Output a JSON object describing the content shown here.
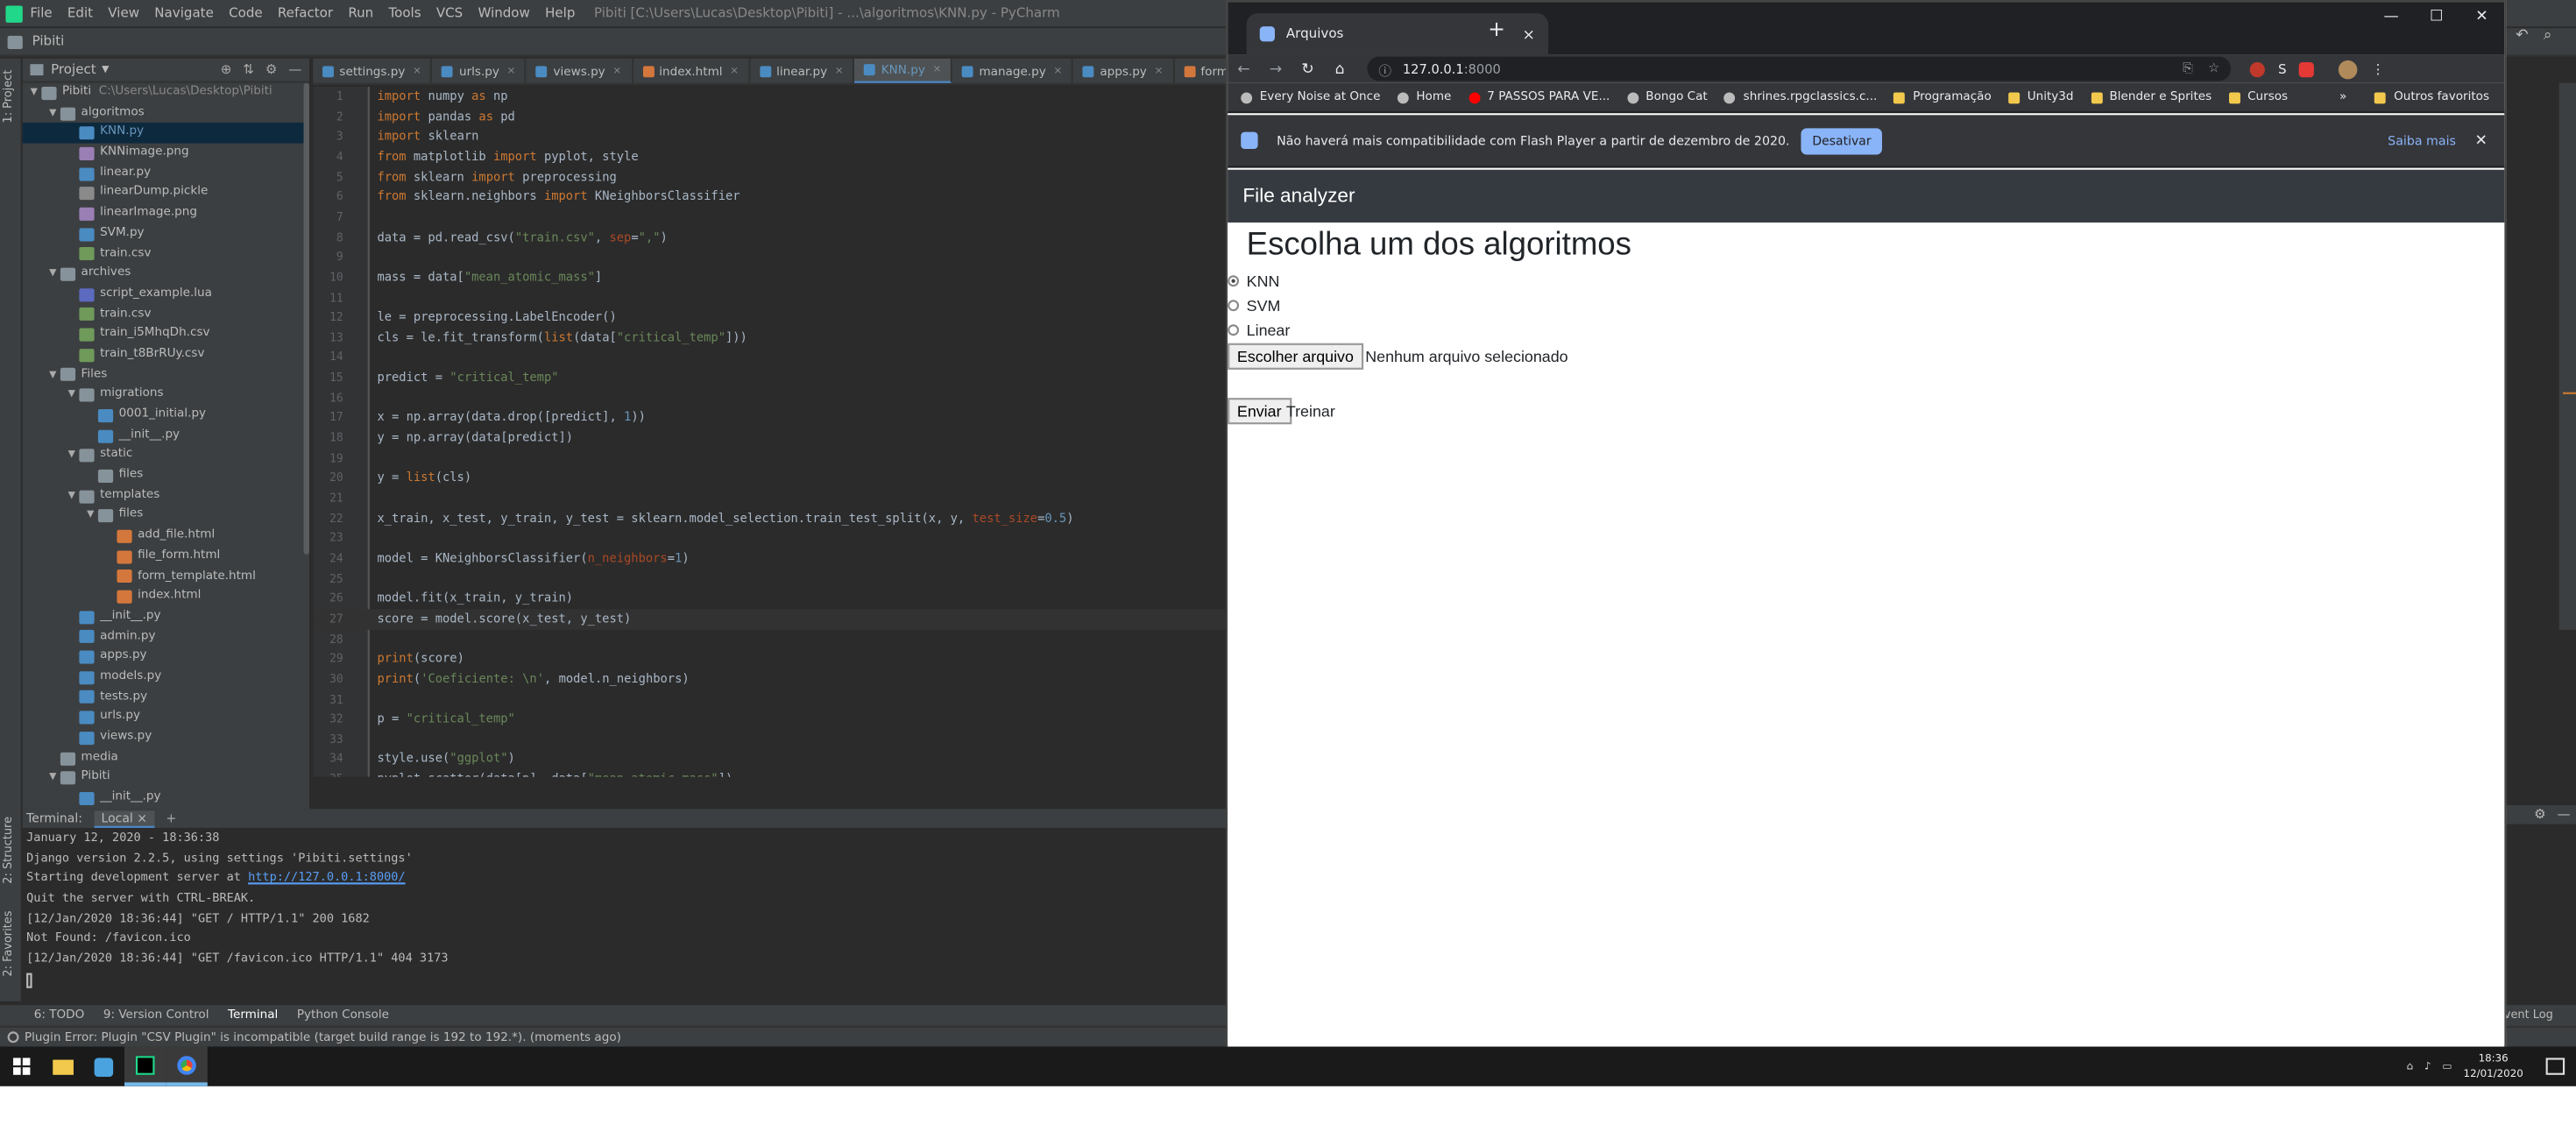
{
  "ide": {
    "title": "Pibiti [C:\\Users\\Lucas\\Desktop\\Pibiti] - ...\\algoritmos\\KNN.py - PyCharm",
    "menu": [
      "File",
      "Edit",
      "View",
      "Navigate",
      "Code",
      "Refactor",
      "Run",
      "Tools",
      "VCS",
      "Window",
      "Help"
    ],
    "nav_project": "Pibiti",
    "project_label": "Project",
    "tree": [
      {
        "name": "Pibiti",
        "sub": "C:\\Users\\Lucas\\Desktop\\Pibiti",
        "depth": 0,
        "arrow": "▼",
        "icon": "folder"
      },
      {
        "name": "algoritmos",
        "depth": 1,
        "arrow": "▼",
        "icon": "folder"
      },
      {
        "name": "KNN.py",
        "depth": 2,
        "icon": "py",
        "sel": true
      },
      {
        "name": "KNNimage.png",
        "depth": 2,
        "icon": "img"
      },
      {
        "name": "linear.py",
        "depth": 2,
        "icon": "py"
      },
      {
        "name": "linearDump.pickle",
        "depth": 2,
        "icon": "pickle"
      },
      {
        "name": "linearImage.png",
        "depth": 2,
        "icon": "img"
      },
      {
        "name": "SVM.py",
        "depth": 2,
        "icon": "py"
      },
      {
        "name": "train.csv",
        "depth": 2,
        "icon": "csv"
      },
      {
        "name": "archives",
        "depth": 1,
        "arrow": "▼",
        "icon": "folder"
      },
      {
        "name": "script_example.lua",
        "depth": 2,
        "icon": "lua"
      },
      {
        "name": "train.csv",
        "depth": 2,
        "icon": "csv"
      },
      {
        "name": "train_i5MhqDh.csv",
        "depth": 2,
        "icon": "csv"
      },
      {
        "name": "train_t8BrRUy.csv",
        "depth": 2,
        "icon": "csv"
      },
      {
        "name": "Files",
        "depth": 1,
        "arrow": "▼",
        "icon": "folder"
      },
      {
        "name": "migrations",
        "depth": 2,
        "arrow": "▼",
        "icon": "folder"
      },
      {
        "name": "0001_initial.py",
        "depth": 3,
        "icon": "py"
      },
      {
        "name": "__init__.py",
        "depth": 3,
        "icon": "py"
      },
      {
        "name": "static",
        "depth": 2,
        "arrow": "▼",
        "icon": "folder"
      },
      {
        "name": "files",
        "depth": 3,
        "icon": "folder"
      },
      {
        "name": "templates",
        "depth": 2,
        "arrow": "▼",
        "icon": "folder"
      },
      {
        "name": "files",
        "depth": 3,
        "arrow": "▼",
        "icon": "folder"
      },
      {
        "name": "add_file.html",
        "depth": 4,
        "icon": "html"
      },
      {
        "name": "file_form.html",
        "depth": 4,
        "icon": "html"
      },
      {
        "name": "form_template.html",
        "depth": 4,
        "icon": "html"
      },
      {
        "name": "index.html",
        "depth": 4,
        "icon": "html"
      },
      {
        "name": "__init__.py",
        "depth": 2,
        "icon": "py"
      },
      {
        "name": "admin.py",
        "depth": 2,
        "icon": "py"
      },
      {
        "name": "apps.py",
        "depth": 2,
        "icon": "py"
      },
      {
        "name": "models.py",
        "depth": 2,
        "icon": "py"
      },
      {
        "name": "tests.py",
        "depth": 2,
        "icon": "py"
      },
      {
        "name": "urls.py",
        "depth": 2,
        "icon": "py"
      },
      {
        "name": "views.py",
        "depth": 2,
        "icon": "py"
      },
      {
        "name": "media",
        "depth": 1,
        "icon": "folder"
      },
      {
        "name": "Pibiti",
        "depth": 1,
        "arrow": "▼",
        "icon": "folder"
      },
      {
        "name": "__init__.py",
        "depth": 2,
        "icon": "py"
      }
    ],
    "tabs": [
      {
        "label": "settings.py",
        "type": "py"
      },
      {
        "label": "urls.py",
        "type": "py"
      },
      {
        "label": "views.py",
        "type": "py"
      },
      {
        "label": "index.html",
        "type": "html"
      },
      {
        "label": "linear.py",
        "type": "py"
      },
      {
        "label": "KNN.py",
        "type": "py",
        "active": true
      },
      {
        "label": "manage.py",
        "type": "py"
      },
      {
        "label": "apps.py",
        "type": "py"
      },
      {
        "label": "form_template.html",
        "type": "html"
      }
    ],
    "code": [
      {
        "n": "1",
        "h": "<span class='kw'>import</span> numpy <span class='kw'>as</span> np"
      },
      {
        "n": "2",
        "h": "<span class='kw'>import</span> pandas <span class='kw'>as</span> pd"
      },
      {
        "n": "3",
        "h": "<span class='kw'>import</span> sklearn"
      },
      {
        "n": "4",
        "h": "<span class='kw'>from</span> matplotlib <span class='kw'>import</span> pyplot, style"
      },
      {
        "n": "5",
        "h": "<span class='kw'>from</span> sklearn <span class='kw'>import</span> preprocessing"
      },
      {
        "n": "6",
        "h": "<span class='kw'>from</span> sklearn.neighbors <span class='kw'>import</span> KNeighborsClassifier"
      },
      {
        "n": "7",
        "h": ""
      },
      {
        "n": "8",
        "h": "data = pd.read_csv(<span class='str'>\"train.csv\"</span>, <span class='prm'>sep</span>=<span class='str'>\",\"</span>)"
      },
      {
        "n": "9",
        "h": ""
      },
      {
        "n": "10",
        "h": "mass = data[<span class='str'>\"mean_atomic_mass\"</span>]"
      },
      {
        "n": "11",
        "h": ""
      },
      {
        "n": "12",
        "h": "le = preprocessing.LabelEncoder()"
      },
      {
        "n": "13",
        "h": "cls = le.fit_transform(<span class='kw'>list</span>(data[<span class='str'>\"critical_temp\"</span>]))"
      },
      {
        "n": "14",
        "h": ""
      },
      {
        "n": "15",
        "h": "predict = <span class='str'>\"critical_temp\"</span>"
      },
      {
        "n": "16",
        "h": ""
      },
      {
        "n": "17",
        "h": "x = np.array(data.drop([predict], <span class='num'>1</span>))"
      },
      {
        "n": "18",
        "h": "y = np.array(data[predict])"
      },
      {
        "n": "19",
        "h": ""
      },
      {
        "n": "20",
        "h": "y = <span class='kw'>list</span>(cls)"
      },
      {
        "n": "21",
        "h": ""
      },
      {
        "n": "22",
        "h": "x_train, x_test, y_train, y_test = sklearn.model_selection.train_test_split(x, y, <span class='prm'>test_size</span>=<span class='num'>0.5</span>)"
      },
      {
        "n": "23",
        "h": ""
      },
      {
        "n": "24",
        "h": "model = KNeighborsClassifier(<span class='prm'>n_neighbors</span>=<span class='num'>1</span>)"
      },
      {
        "n": "25",
        "h": ""
      },
      {
        "n": "26",
        "h": "model.fit(x_train, y_train)"
      },
      {
        "n": "27",
        "h": "score = model.score(x_test, y_test)",
        "cur": true
      },
      {
        "n": "28",
        "h": ""
      },
      {
        "n": "29",
        "h": "<span class='kw'>print</span>(score)"
      },
      {
        "n": "30",
        "h": "<span class='kw'>print</span>(<span class='str'>'Coeficiente: \\n'</span>, model.n_neighbors)"
      },
      {
        "n": "31",
        "h": ""
      },
      {
        "n": "32",
        "h": "p = <span class='str'>\"critical_temp\"</span>"
      },
      {
        "n": "33",
        "h": ""
      },
      {
        "n": "34",
        "h": "style.use(<span class='str'>\"ggplot\"</span>)"
      },
      {
        "n": "35",
        "h": "pyplot.scatter(data[p], data[<span class='str'>\"mean_atomic_mass\"</span>])"
      }
    ],
    "terminal": {
      "label": "Terminal:",
      "tab": "Local",
      "lines": [
        "January 12, 2020 - 18:36:38",
        "Django version 2.2.5, using settings 'Pibiti.settings'",
        "Starting development server at ",
        "Quit the server with CTRL-BREAK.",
        "[12/Jan/2020 18:36:44] \"GET / HTTP/1.1\" 200 1682",
        "Not Found: /favicon.ico",
        "[12/Jan/2020 18:36:44] \"GET /favicon.ico HTTP/1.1\" 404 3173"
      ],
      "link": "http://127.0.0.1:8000/"
    },
    "bottom_tabs": [
      "6: TODO",
      "9: Version Control",
      "Terminal",
      "Python Console"
    ],
    "event_log": "Event Log",
    "status": "Plugin Error: Plugin \"CSV Plugin\" is incompatible (target build range is 192 to 192.*). (moments ago)",
    "side_labels": {
      "project": "1: Project",
      "structure": "2: Structure",
      "favorites": "2: Favorites"
    }
  },
  "browser": {
    "tab_title": "Arquivos",
    "url_host": "127.0.0.1",
    "url_port": ":8000",
    "bookmarks": [
      {
        "label": "Every Noise at Once",
        "icon": "globe"
      },
      {
        "label": "Home",
        "icon": "globe"
      },
      {
        "label": "7 PASSOS PARA VE...",
        "icon": "yt"
      },
      {
        "label": "Bongo Cat",
        "icon": "globe"
      },
      {
        "label": "shrines.rpgclassics.c...",
        "icon": "globe"
      },
      {
        "label": "Programação",
        "icon": "folder"
      },
      {
        "label": "Unity3d",
        "icon": "folder"
      },
      {
        "label": "Blender e Sprites",
        "icon": "folder"
      },
      {
        "label": "Cursos",
        "icon": "folder"
      }
    ],
    "bookmarks_more": "»",
    "other_bookmarks": "Outros favoritos",
    "infobar": {
      "text": "Não haverá mais compatibilidade com Flash Player a partir de dezembro de 2020.",
      "button": "Desativar",
      "learn_more": "Saiba mais"
    }
  },
  "webpage": {
    "brand": "File analyzer",
    "heading": "Escolha um dos algoritmos",
    "options": [
      "KNN",
      "SVM",
      "Linear"
    ],
    "selected": "KNN",
    "file_button": "Escolher arquivo",
    "file_status": "Nenhum arquivo selecionado",
    "submit": "Enviar",
    "train_link": "Treinar"
  },
  "taskbar": {
    "time": "18:36",
    "date": "12/01/2020"
  }
}
